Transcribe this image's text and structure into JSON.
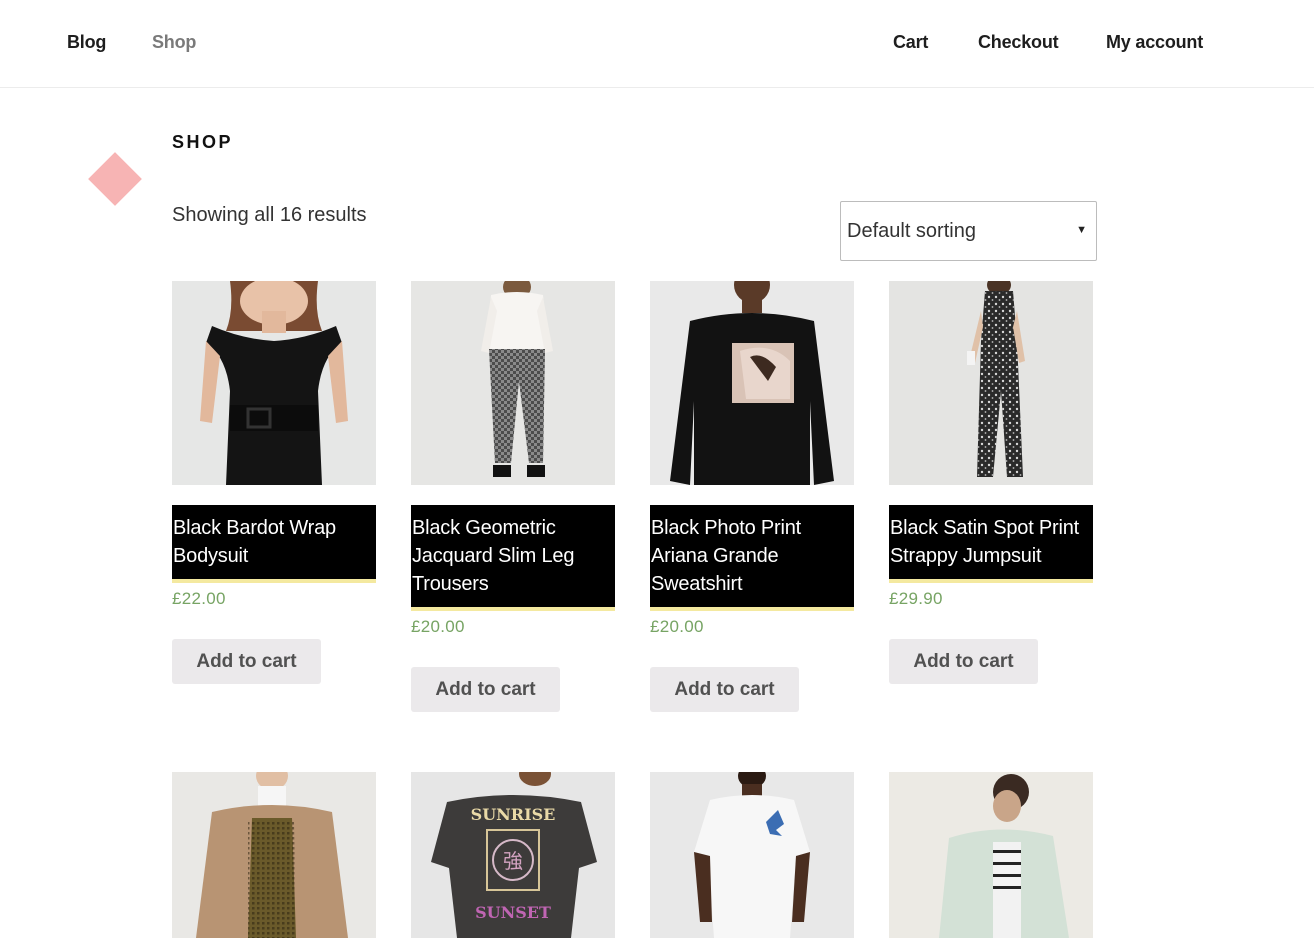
{
  "nav": {
    "left": [
      {
        "label": "Blog"
      },
      {
        "label": "Shop"
      }
    ],
    "right": [
      {
        "label": "Cart"
      },
      {
        "label": "Checkout"
      },
      {
        "label": "My account"
      }
    ]
  },
  "page": {
    "title": "SHOP",
    "result_count": "Showing all 16 results",
    "sort_selected": "Default sorting",
    "accent_color": "#f7b4b4"
  },
  "products": [
    {
      "title": "Black Bardot Wrap Bodysuit",
      "price": "£22.00",
      "button": "Add to cart"
    },
    {
      "title": "Black Geometric Jacquard Slim Leg Trousers",
      "price": "£20.00",
      "button": "Add to cart"
    },
    {
      "title": "Black Photo Print Ariana Grande Sweatshirt",
      "price": "£20.00",
      "button": "Add to cart"
    },
    {
      "title": "Black Satin Spot Print Strappy Jumpsuit",
      "price": "£29.90",
      "button": "Add to cart"
    }
  ],
  "second_row_images": [
    {
      "image": "tan teddy coat product photo"
    },
    {
      "image": "grey sunrise graphic t-shirt product photo"
    },
    {
      "image": "white floral print t-shirt product photo"
    },
    {
      "image": "mint denim jacket product photo"
    }
  ],
  "colors": {
    "price": "#77a464",
    "title_background": "#000000",
    "title_underline": "#f4e9a0",
    "button_background": "#ebe9eb"
  }
}
